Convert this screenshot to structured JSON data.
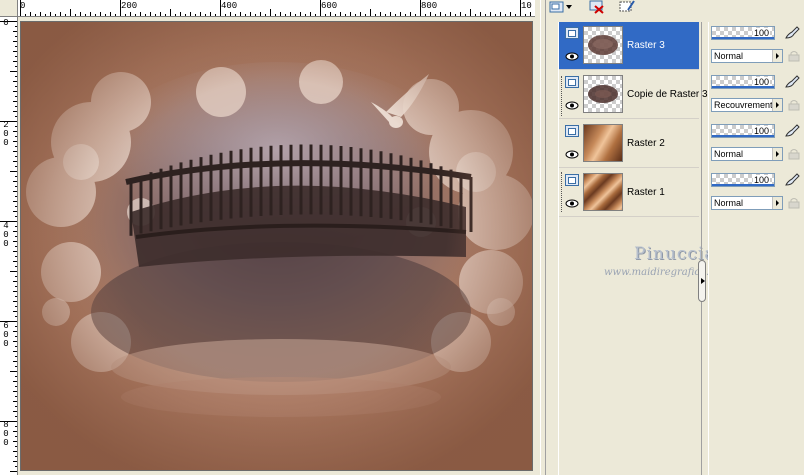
{
  "ruler": {
    "top_labels": [
      "0",
      "200",
      "400",
      "600",
      "800",
      "10"
    ],
    "left_labels": [
      "0",
      "2\n0\n0",
      "4\n0\n0",
      "6\n0\n0",
      "8\n0\n0"
    ]
  },
  "toolbar": {
    "icons": [
      "new-layer-icon",
      "dropdown-arrow-icon",
      "delete-layer-icon",
      "edit-mask-icon"
    ]
  },
  "layers": [
    {
      "name": "Raster 3",
      "selected": true,
      "thumb": "dark-blur"
    },
    {
      "name": "Copie de Raster 3",
      "selected": false,
      "thumb": "dark-blur"
    },
    {
      "name": "Raster 2",
      "selected": false,
      "thumb": "copper-gradient"
    },
    {
      "name": "Raster 1",
      "selected": false,
      "thumb": "copper-stripes"
    }
  ],
  "properties": [
    {
      "opacity": "100",
      "blend_mode": "Normal"
    },
    {
      "opacity": "100",
      "blend_mode": "Recouvrement"
    },
    {
      "opacity": "100",
      "blend_mode": "Normal"
    },
    {
      "opacity": "100",
      "blend_mode": "Normal"
    }
  ],
  "watermark": {
    "name": "Pinuccia",
    "url": "www.maidiregrafica.eu"
  },
  "colors": {
    "selection": "#316ac5",
    "panel_bg": "#ece9d8",
    "sepia_light": "#d8b09a",
    "sepia_dark": "#8a5a43"
  }
}
